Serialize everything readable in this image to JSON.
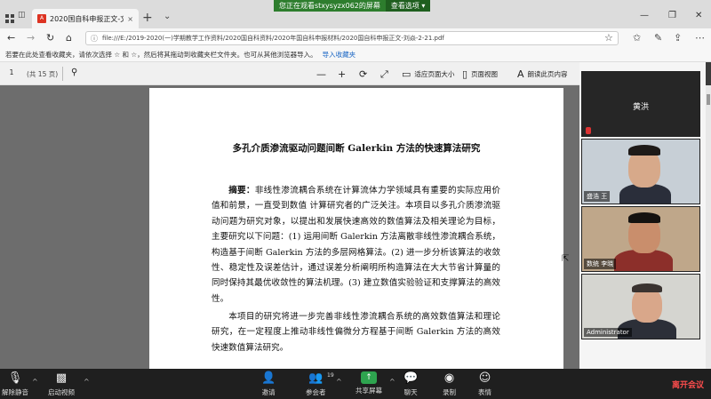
{
  "browser": {
    "tab_title": "2020国自科申报正文-文",
    "tab_close": "×",
    "new_tab": "+",
    "tab_menu": "⌄",
    "url": "file:///E:/2019-2020(一)学期教学工作资料/2020国自科资料/2020年国自科申报材料/2020国自科申报正文-刘焱-2-21.pdf",
    "nav": {
      "back": "←",
      "forward": "→",
      "refresh": "↻",
      "home": "⌂"
    },
    "window_controls": {
      "minimize": "—",
      "maximize": "❐",
      "close": "✕"
    },
    "favbar_text": "若要在此处查看收藏夹，请依次选择 ☆ 和 ☆，然后将其拖动到收藏夹栏文件夹。也可从其他浏览器导入。",
    "favbar_import": "导入收藏夹"
  },
  "screen_share": {
    "message": "您正在观看stxysyzx062的屏幕",
    "options": "查看选项 ▾"
  },
  "pdf_toolbar": {
    "page": "1",
    "page_count": "(共 15 页)",
    "zoom_out": "—",
    "zoom_in": "+",
    "rotate": "⟳",
    "fit": "⤢",
    "fit_page_label": "适应页面大小",
    "page_view_label": "页面视图",
    "read_aloud_label": "朗读此页内容"
  },
  "document": {
    "title": "多孔介质渗流驱动问题间断 Galerkin 方法的快速算法研究",
    "abstract_label": "摘要：",
    "abstract_text": "非线性渗流耦合系统在计算流体力学领域具有重要的实际应用价值和前景，一直受到数值 计算研究者的广泛关注。本项目以多孔介质渗流驱动问题为研究对象，以提出和发展快速高效的数值算法及相关理论为目标，主要研究以下问题：(1) 运用间断 Galerkin 方法离散非线性渗流耦合系统， 构造基于间断 Galerkin 方法的多层网格算法。(2) 进一步分析该算法的收敛性、稳定性及误差估计，通过误差分析阐明所构造算法在大大节省计算量的同时保持其最优收敛性的算法机理。(3) 建立数值实验验证和支撑算法的高效性。",
    "paragraph2": "本项目的研究将进一步完善非线性渗流耦合系统的高效数值算法和理论研究，在一定程度上推动非线性偏微分方程基于间断 Galerkin 方法的高效快速数值算法研究。"
  },
  "gallery": {
    "participants": [
      {
        "name": "黄洪"
      },
      {
        "name": "盛浩 王"
      },
      {
        "name": "数统 李晓"
      },
      {
        "name": "Administrator"
      }
    ]
  },
  "meeting_toolbar": {
    "unmute": "解除静音",
    "start_video": "启动视频",
    "invite": "邀请",
    "participants": "参会者",
    "participants_count": "19",
    "share_screen": "共享屏幕",
    "chat": "聊天",
    "record": "录制",
    "reactions": "表情",
    "leave": "离开会议"
  },
  "colors": {
    "share_green": "#2d7d2d",
    "leave_red": "#ff4d4d",
    "import_link": "#1a66c4"
  }
}
